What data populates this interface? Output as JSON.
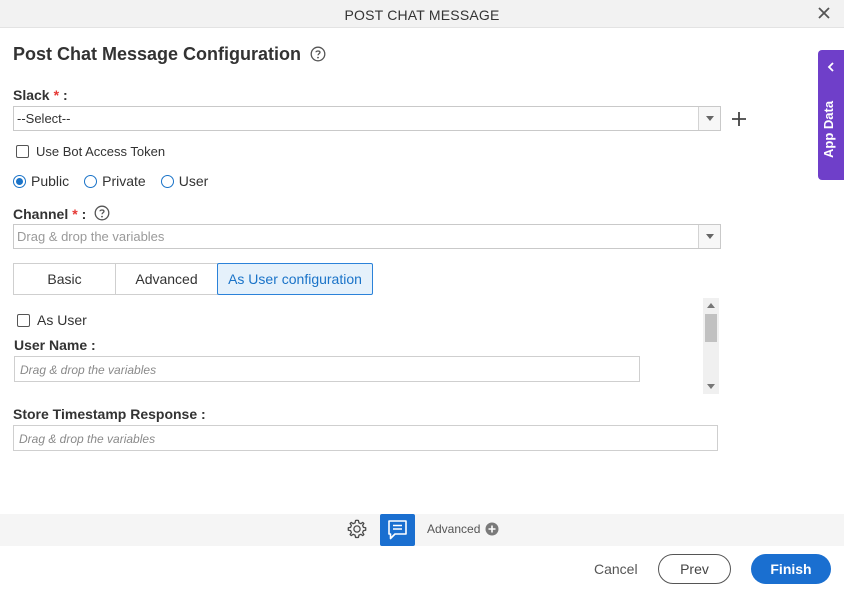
{
  "window": {
    "title": "POST CHAT MESSAGE"
  },
  "page": {
    "heading": "Post Chat Message Configuration"
  },
  "slack": {
    "label": "Slack",
    "required_mark": "*",
    "colon": ":",
    "selected": "--Select--"
  },
  "bot_token": {
    "label": "Use Bot Access Token"
  },
  "visibility": {
    "options": [
      "Public",
      "Private",
      "User"
    ],
    "selected": "Public"
  },
  "channel": {
    "label": "Channel",
    "required_mark": "*",
    "colon": ":",
    "placeholder": "Drag & drop the variables"
  },
  "tabs": [
    {
      "label": "Basic"
    },
    {
      "label": "Advanced"
    },
    {
      "label": "As User configuration"
    }
  ],
  "active_tab": "As User configuration",
  "as_user": {
    "checkbox_label": "As User",
    "username_label": "User Name :",
    "username_placeholder": "Drag & drop the variables"
  },
  "timestamp": {
    "label": "Store Timestamp Response :",
    "placeholder": "Drag & drop the variables"
  },
  "footer": {
    "advanced_label": "Advanced",
    "cancel": "Cancel",
    "prev": "Prev",
    "finish": "Finish"
  },
  "side_panel": {
    "label": "App Data"
  },
  "colors": {
    "primary": "#1a6fd0",
    "side_panel": "#6f3fc9",
    "required": "#e53935"
  },
  "icons": [
    "close-icon",
    "help-icon",
    "plus-icon",
    "gear-icon",
    "chat-message-icon",
    "plus-circle-icon",
    "chevron-left-icon"
  ]
}
